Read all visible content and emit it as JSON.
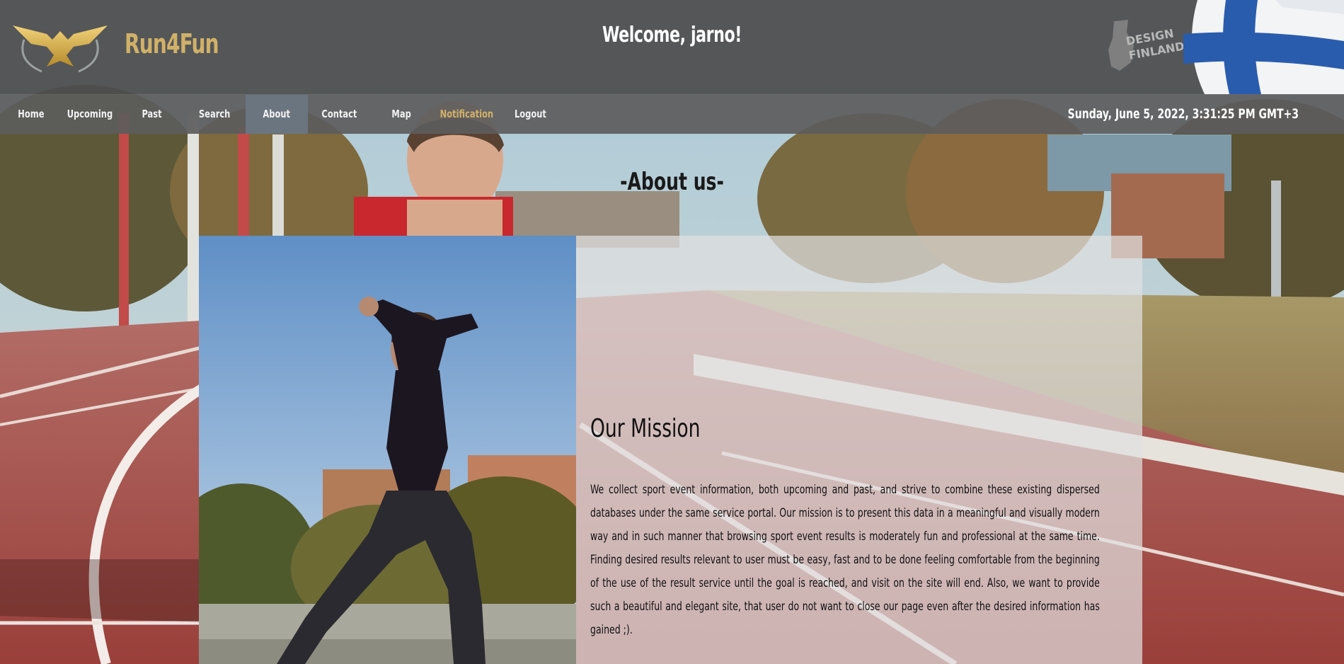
{
  "header": {
    "brand": "Run4Fun",
    "welcome": "Welcome, jarno!",
    "design_badge_line1": "DESIGN",
    "design_badge_line2": "FINLAND",
    "logo_icon": "golden-eagle-icon",
    "flag_icon": "finland-flag"
  },
  "nav": {
    "items": [
      {
        "label": "Home"
      },
      {
        "label": "Upcoming"
      },
      {
        "label": "Past"
      },
      {
        "label": "Search"
      },
      {
        "label": "About"
      },
      {
        "label": "Contact"
      },
      {
        "label": "Map"
      },
      {
        "label": "Notification"
      },
      {
        "label": "Logout"
      }
    ],
    "active": "About",
    "datetime": "Sunday, June 5, 2022, 3:31:25 PM GMT+3"
  },
  "about": {
    "title": "-About us-",
    "mission_heading": "Our Mission",
    "mission_text": "We collect sport event information, both upcoming and past, and strive to combine these existing dispersed databases under the same service portal. Our mission is to present this data in a meaningful and visually modern way and in such manner that browsing sport event results is moderately fun and professional at the same time. Finding desired results relevant to user must be easy, fast and to be done feeling comfortable from the beginning of the use of the result service until the goal is reached, and visit on the site will end. Also, we want to provide such a beautiful and elegant site, that user do not want to close our page even after the desired information has gained ;)."
  },
  "colors": {
    "accent_gold": "#d1b169",
    "header_bg": "#4e4e4e",
    "nav_bg": "#5c5c5c",
    "nav_active": "#6a7580"
  }
}
